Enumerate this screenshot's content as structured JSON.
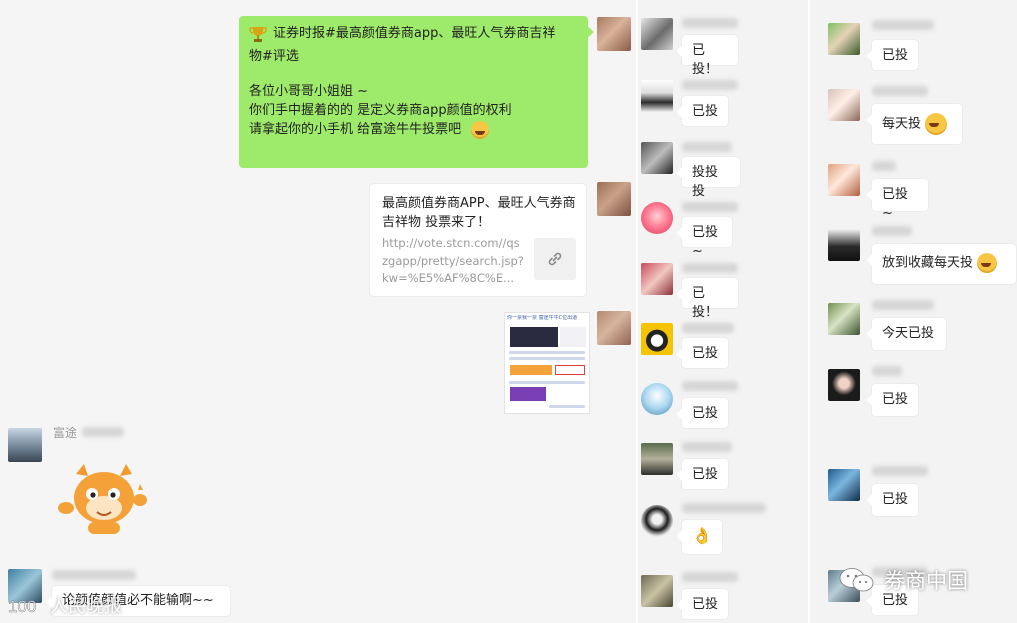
{
  "left_chat": {
    "announcement": {
      "line1": "证券时报#最高颜值券商app、最旺人气券商吉祥",
      "line2": "物#评选",
      "line3": "各位小哥哥小姐姐 ~",
      "line4": "你们手中握着的的 是定义券商app颜值的权利",
      "line5": "请拿起你的小手机 给富途牛牛投票吧"
    },
    "link_card": {
      "title": "最高颜值券商APP、最旺人气券商吉祥物 投票来了！",
      "url": "http://vote.stcn.com//qszgapp/pretty/search.jsp?kw=%E5%AF%8C%E..."
    },
    "thumb": {
      "header": "你一票我一票  富途牛牛C位出道"
    },
    "futu_sender_name": "富途",
    "last_message": "论颜值颜值必不能输啊~~"
  },
  "middle_chat": [
    {
      "text": "已投！"
    },
    {
      "text": "已投"
    },
    {
      "text": "投投投"
    },
    {
      "text": "已投~"
    },
    {
      "text": "已投！"
    },
    {
      "text": "已投"
    },
    {
      "text": "已投"
    },
    {
      "text": "已投"
    },
    {
      "text": "👌"
    },
    {
      "text": "已投"
    }
  ],
  "right_chat": [
    {
      "text": "已投"
    },
    {
      "text": "每天投"
    },
    {
      "text": "已投~"
    },
    {
      "text": "放到收藏每天投"
    },
    {
      "text": "今天已投"
    },
    {
      "text": "已投"
    },
    {
      "text": "已投"
    },
    {
      "text": "已投"
    }
  ],
  "watermarks": {
    "bottom_left": "人民晚报",
    "bottom_right": "券商中国"
  },
  "colors": {
    "green_bubble": "#9eea6a",
    "chat_bg": "#f5f5f5"
  }
}
